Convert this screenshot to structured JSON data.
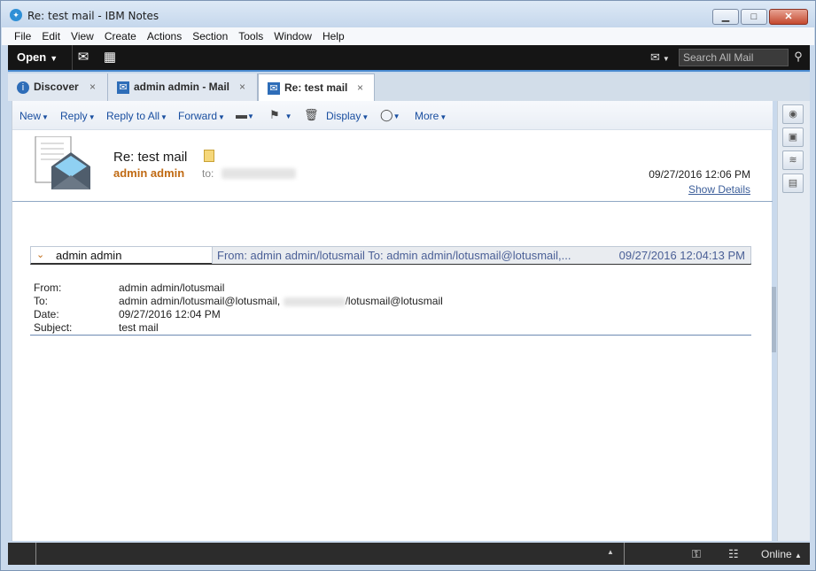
{
  "window": {
    "title": "Re: test mail - IBM Notes",
    "minimize_glyph": "▁",
    "maximize_glyph": "□",
    "close_glyph": "✕"
  },
  "menu": [
    "File",
    "Edit",
    "View",
    "Create",
    "Actions",
    "Section",
    "Tools",
    "Window",
    "Help"
  ],
  "topbar": {
    "open_label": "Open",
    "search_placeholder": "Search All Mail"
  },
  "tabs": [
    {
      "label": "Discover",
      "icon": "info-icon"
    },
    {
      "label": "admin admin - Mail",
      "icon": "mail-icon"
    },
    {
      "label": "Re: test mail",
      "icon": "mail-icon",
      "active": true
    }
  ],
  "actions": {
    "new": "New",
    "reply": "Reply",
    "reply_all": "Reply to All",
    "forward": "Forward",
    "display": "Display",
    "more": "More"
  },
  "message": {
    "subject": "Re: test mail",
    "from": "admin admin",
    "to_label": "to:",
    "date": "09/27/2016 12:06 PM",
    "show_details": "Show Details"
  },
  "thread": {
    "name": "admin admin",
    "summary": "From: admin admin/lotusmail To: admin admin/lotusmail@lotusmail,...",
    "date": "09/27/2016 12:04:13 PM"
  },
  "headers": {
    "from_label": "From:",
    "from_value": "admin admin/lotusmail",
    "to_label": "To:",
    "to_value_a": "admin admin/lotusmail@lotusmail,",
    "to_value_b": "/lotusmail@lotusmail",
    "date_label": "Date:",
    "date_value": "09/27/2016 12:04 PM",
    "subject_label": "Subject:",
    "subject_value": "test mail"
  },
  "status": {
    "online": "Online"
  },
  "colors": {
    "accent": "#1a4fa0",
    "sender": "#c06a13",
    "toolbar_dark": "#151515"
  }
}
